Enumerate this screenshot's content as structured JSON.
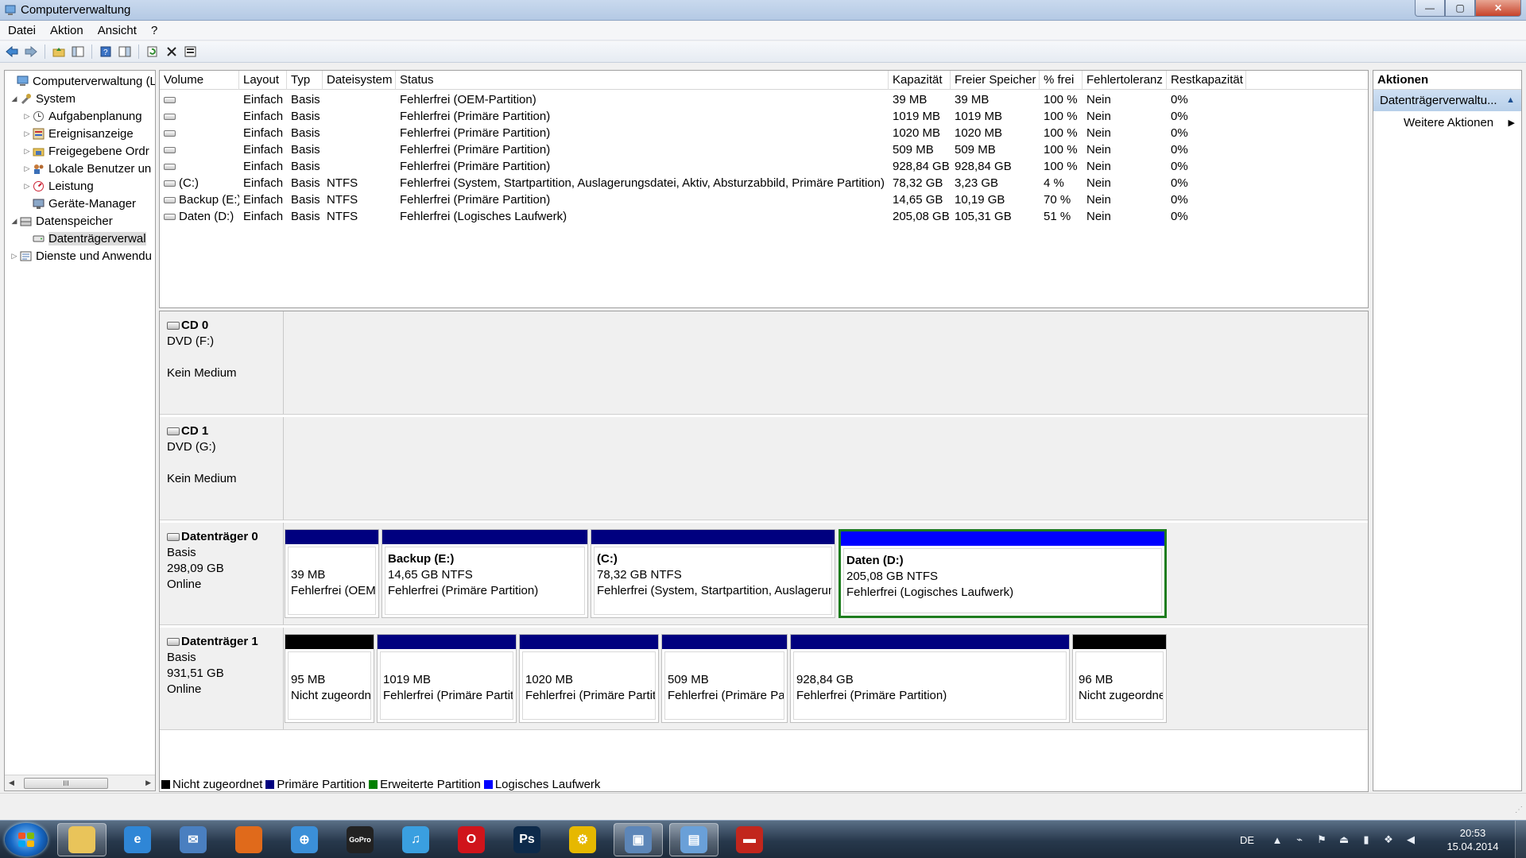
{
  "window": {
    "title": "Computerverwaltung",
    "minimize": "—",
    "maximize": "▢",
    "close": "✕"
  },
  "menu": [
    "Datei",
    "Aktion",
    "Ansicht",
    "?"
  ],
  "tree": {
    "items": [
      {
        "label": "Computerverwaltung (Lc",
        "level": 0,
        "expander": "",
        "icon": "computer-icon"
      },
      {
        "label": "System",
        "level": 1,
        "expander": "◢",
        "icon": "tools-icon"
      },
      {
        "label": "Aufgabenplanung",
        "level": 2,
        "expander": "▷",
        "icon": "clock-icon"
      },
      {
        "label": "Ereignisanzeige",
        "level": 2,
        "expander": "▷",
        "icon": "event-viewer-icon"
      },
      {
        "label": "Freigegebene Ordr",
        "level": 2,
        "expander": "▷",
        "icon": "shared-folder-icon"
      },
      {
        "label": "Lokale Benutzer un",
        "level": 2,
        "expander": "▷",
        "icon": "users-icon"
      },
      {
        "label": "Leistung",
        "level": 2,
        "expander": "▷",
        "icon": "performance-icon"
      },
      {
        "label": "Geräte-Manager",
        "level": 2,
        "expander": "",
        "icon": "device-manager-icon"
      },
      {
        "label": "Datenspeicher",
        "level": 1,
        "expander": "◢",
        "icon": "storage-icon"
      },
      {
        "label": "Datenträgerverwal",
        "level": 2,
        "expander": "",
        "icon": "disk-management-icon",
        "selected": true
      },
      {
        "label": "Dienste und Anwendu",
        "level": 1,
        "expander": "▷",
        "icon": "services-icon"
      }
    ],
    "scroll_thumb": "III"
  },
  "volumes": {
    "columns": [
      "Volume",
      "Layout",
      "Typ",
      "Dateisystem",
      "Status",
      "Kapazität",
      "Freier Speicher",
      "% frei",
      "Fehlertoleranz",
      "Restkapazität"
    ],
    "rows": [
      [
        "",
        "Einfach",
        "Basis",
        "",
        "Fehlerfrei (OEM-Partition)",
        "39 MB",
        "39 MB",
        "100 %",
        "Nein",
        "0%"
      ],
      [
        "",
        "Einfach",
        "Basis",
        "",
        "Fehlerfrei (Primäre Partition)",
        "1019 MB",
        "1019 MB",
        "100 %",
        "Nein",
        "0%"
      ],
      [
        "",
        "Einfach",
        "Basis",
        "",
        "Fehlerfrei (Primäre Partition)",
        "1020 MB",
        "1020 MB",
        "100 %",
        "Nein",
        "0%"
      ],
      [
        "",
        "Einfach",
        "Basis",
        "",
        "Fehlerfrei (Primäre Partition)",
        "509 MB",
        "509 MB",
        "100 %",
        "Nein",
        "0%"
      ],
      [
        "",
        "Einfach",
        "Basis",
        "",
        "Fehlerfrei (Primäre Partition)",
        "928,84 GB",
        "928,84 GB",
        "100 %",
        "Nein",
        "0%"
      ],
      [
        "(C:)",
        "Einfach",
        "Basis",
        "NTFS",
        "Fehlerfrei (System, Startpartition, Auslagerungsdatei, Aktiv, Absturzabbild, Primäre Partition)",
        "78,32 GB",
        "3,23 GB",
        "4 %",
        "Nein",
        "0%"
      ],
      [
        "Backup (E:)",
        "Einfach",
        "Basis",
        "NTFS",
        "Fehlerfrei (Primäre Partition)",
        "14,65 GB",
        "10,19 GB",
        "70 %",
        "Nein",
        "0%"
      ],
      [
        "Daten (D:)",
        "Einfach",
        "Basis",
        "NTFS",
        "Fehlerfrei (Logisches Laufwerk)",
        "205,08 GB",
        "105,31 GB",
        "51 %",
        "Nein",
        "0%"
      ]
    ]
  },
  "disks": [
    {
      "name": "CD 0",
      "lines": [
        "DVD (F:)",
        "",
        "Kein Medium"
      ],
      "kind": "cd",
      "partitions": []
    },
    {
      "name": "CD 1",
      "lines": [
        "DVD (G:)",
        "",
        "Kein Medium"
      ],
      "kind": "cd",
      "partitions": []
    },
    {
      "name": "Datenträger 0",
      "lines": [
        "Basis",
        "298,09 GB",
        "Online"
      ],
      "kind": "disk",
      "partitions": [
        {
          "name": "",
          "line1": "39 MB",
          "line2": "Fehlerfrei (OEM-",
          "bar": "#00007f"
        },
        {
          "name": "Backup  (E:)",
          "line1": "14,65 GB NTFS",
          "line2": "Fehlerfrei (Primäre Partition)",
          "bar": "#00007f"
        },
        {
          "name": "(C:)",
          "line1": "78,32 GB NTFS",
          "line2": "Fehlerfrei (System, Startpartition, Auslagerungsdatei, Ak",
          "bar": "#00007f"
        },
        {
          "name": "Daten  (D:)",
          "line1": "205,08 GB NTFS",
          "line2": "Fehlerfrei (Logisches Laufwerk)",
          "bar": "#0000ff",
          "selected": true
        }
      ]
    },
    {
      "name": "Datenträger 1",
      "lines": [
        "Basis",
        "931,51 GB",
        "Online"
      ],
      "kind": "disk",
      "partitions": [
        {
          "name": "",
          "line1": "95 MB",
          "line2": "Nicht zugeordnet",
          "bar": "#000000"
        },
        {
          "name": "",
          "line1": "1019 MB",
          "line2": "Fehlerfrei (Primäre Partition)",
          "bar": "#00007f"
        },
        {
          "name": "",
          "line1": "1020 MB",
          "line2": "Fehlerfrei (Primäre Partition)",
          "bar": "#00007f"
        },
        {
          "name": "",
          "line1": "509 MB",
          "line2": "Fehlerfrei (Primäre Partition",
          "bar": "#00007f"
        },
        {
          "name": "",
          "line1": "928,84 GB",
          "line2": "Fehlerfrei (Primäre Partition)",
          "bar": "#00007f"
        },
        {
          "name": "",
          "line1": "96 MB",
          "line2": "Nicht zugeordnet",
          "bar": "#000000"
        }
      ]
    }
  ],
  "legend": [
    {
      "label": "Nicht zugeordnet",
      "color": "#000000"
    },
    {
      "label": "Primäre Partition",
      "color": "#00007f"
    },
    {
      "label": "Erweiterte Partition",
      "color": "#008000"
    },
    {
      "label": "Logisches Laufwerk",
      "color": "#0000ff"
    }
  ],
  "actions": {
    "header": "Aktionen",
    "section": "Datenträgerverwaltu...",
    "items": [
      "Weitere Aktionen"
    ]
  },
  "taskbar": {
    "apps": [
      {
        "name": "explorer",
        "icon": "folder-icon",
        "color": "#e9c45a",
        "glyph": "",
        "active": true
      },
      {
        "name": "internet-explorer",
        "icon": "ie-icon",
        "color": "#2f86d6",
        "glyph": "e"
      },
      {
        "name": "thunderbird",
        "icon": "thunderbird-icon",
        "color": "#4a7fc0",
        "glyph": "✉"
      },
      {
        "name": "firefox",
        "icon": "firefox-icon",
        "color": "#e06a1b",
        "glyph": ""
      },
      {
        "name": "safari",
        "icon": "safari-icon",
        "color": "#3b8fd8",
        "glyph": "⊕"
      },
      {
        "name": "gopro",
        "icon": "gopro-icon",
        "color": "#222222",
        "glyph": "GoPro"
      },
      {
        "name": "itunes",
        "icon": "itunes-icon",
        "color": "#3a9fe0",
        "glyph": "♫"
      },
      {
        "name": "opera",
        "icon": "opera-icon",
        "color": "#d0141b",
        "glyph": "O"
      },
      {
        "name": "photoshop",
        "icon": "photoshop-icon",
        "color": "#0d2a4a",
        "glyph": "Ps"
      },
      {
        "name": "tools",
        "icon": "tools-app-icon",
        "color": "#e6b800",
        "glyph": "⚙"
      },
      {
        "name": "network",
        "icon": "network-icon",
        "color": "#5d86b8",
        "glyph": "▣",
        "active": true
      },
      {
        "name": "computer-management",
        "icon": "computer-management-icon",
        "color": "#6aa0d8",
        "glyph": "▤",
        "active": true
      },
      {
        "name": "toolbox",
        "icon": "toolbox-icon",
        "color": "#c2261d",
        "glyph": "▬"
      }
    ],
    "lang": "DE",
    "time": "20:53",
    "date": "15.04.2014"
  }
}
